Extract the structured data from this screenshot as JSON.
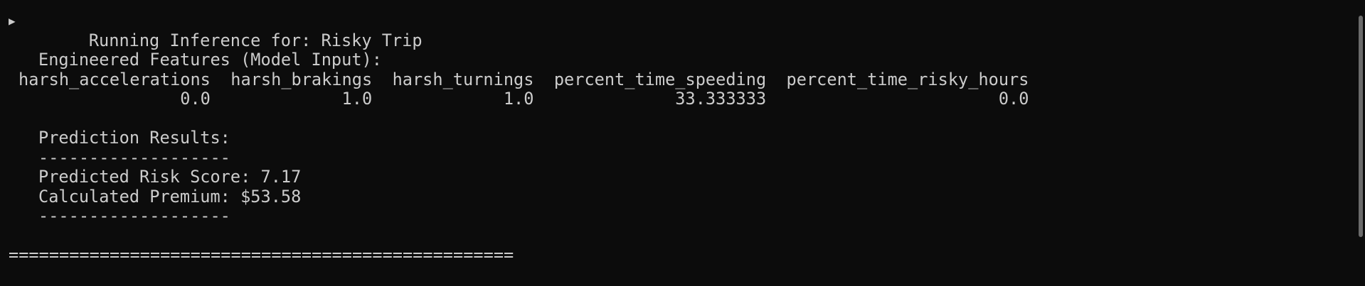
{
  "window": {
    "running_marker_icon": "play-triangle-icon",
    "running_line": "Running Inference for: Risky Trip"
  },
  "features": {
    "heading": "Engineered Features (Model Input):",
    "header_row": "harsh_accelerations  harsh_brakings  harsh_turnings  percent_time_speeding  percent_time_risky_hours",
    "value_row": "                0.0             1.0             1.0              33.333333                       0.0",
    "columns": [
      "harsh_accelerations",
      "harsh_brakings",
      "harsh_turnings",
      "percent_time_speeding",
      "percent_time_risky_hours"
    ],
    "values": [
      "0.0",
      "1.0",
      "1.0",
      "33.333333",
      "0.0"
    ]
  },
  "results": {
    "heading": "Prediction Results:",
    "divider_top": "-------------------",
    "risk_score_line": "Predicted Risk Score: 7.17",
    "premium_line": "Calculated Premium: $53.58",
    "divider_bottom": "-------------------"
  },
  "footer": {
    "separator": "=================================================="
  },
  "colors": {
    "background": "#0c0c0c",
    "text": "#cccccc",
    "scrollbar_thumb": "#6b6b6b"
  }
}
